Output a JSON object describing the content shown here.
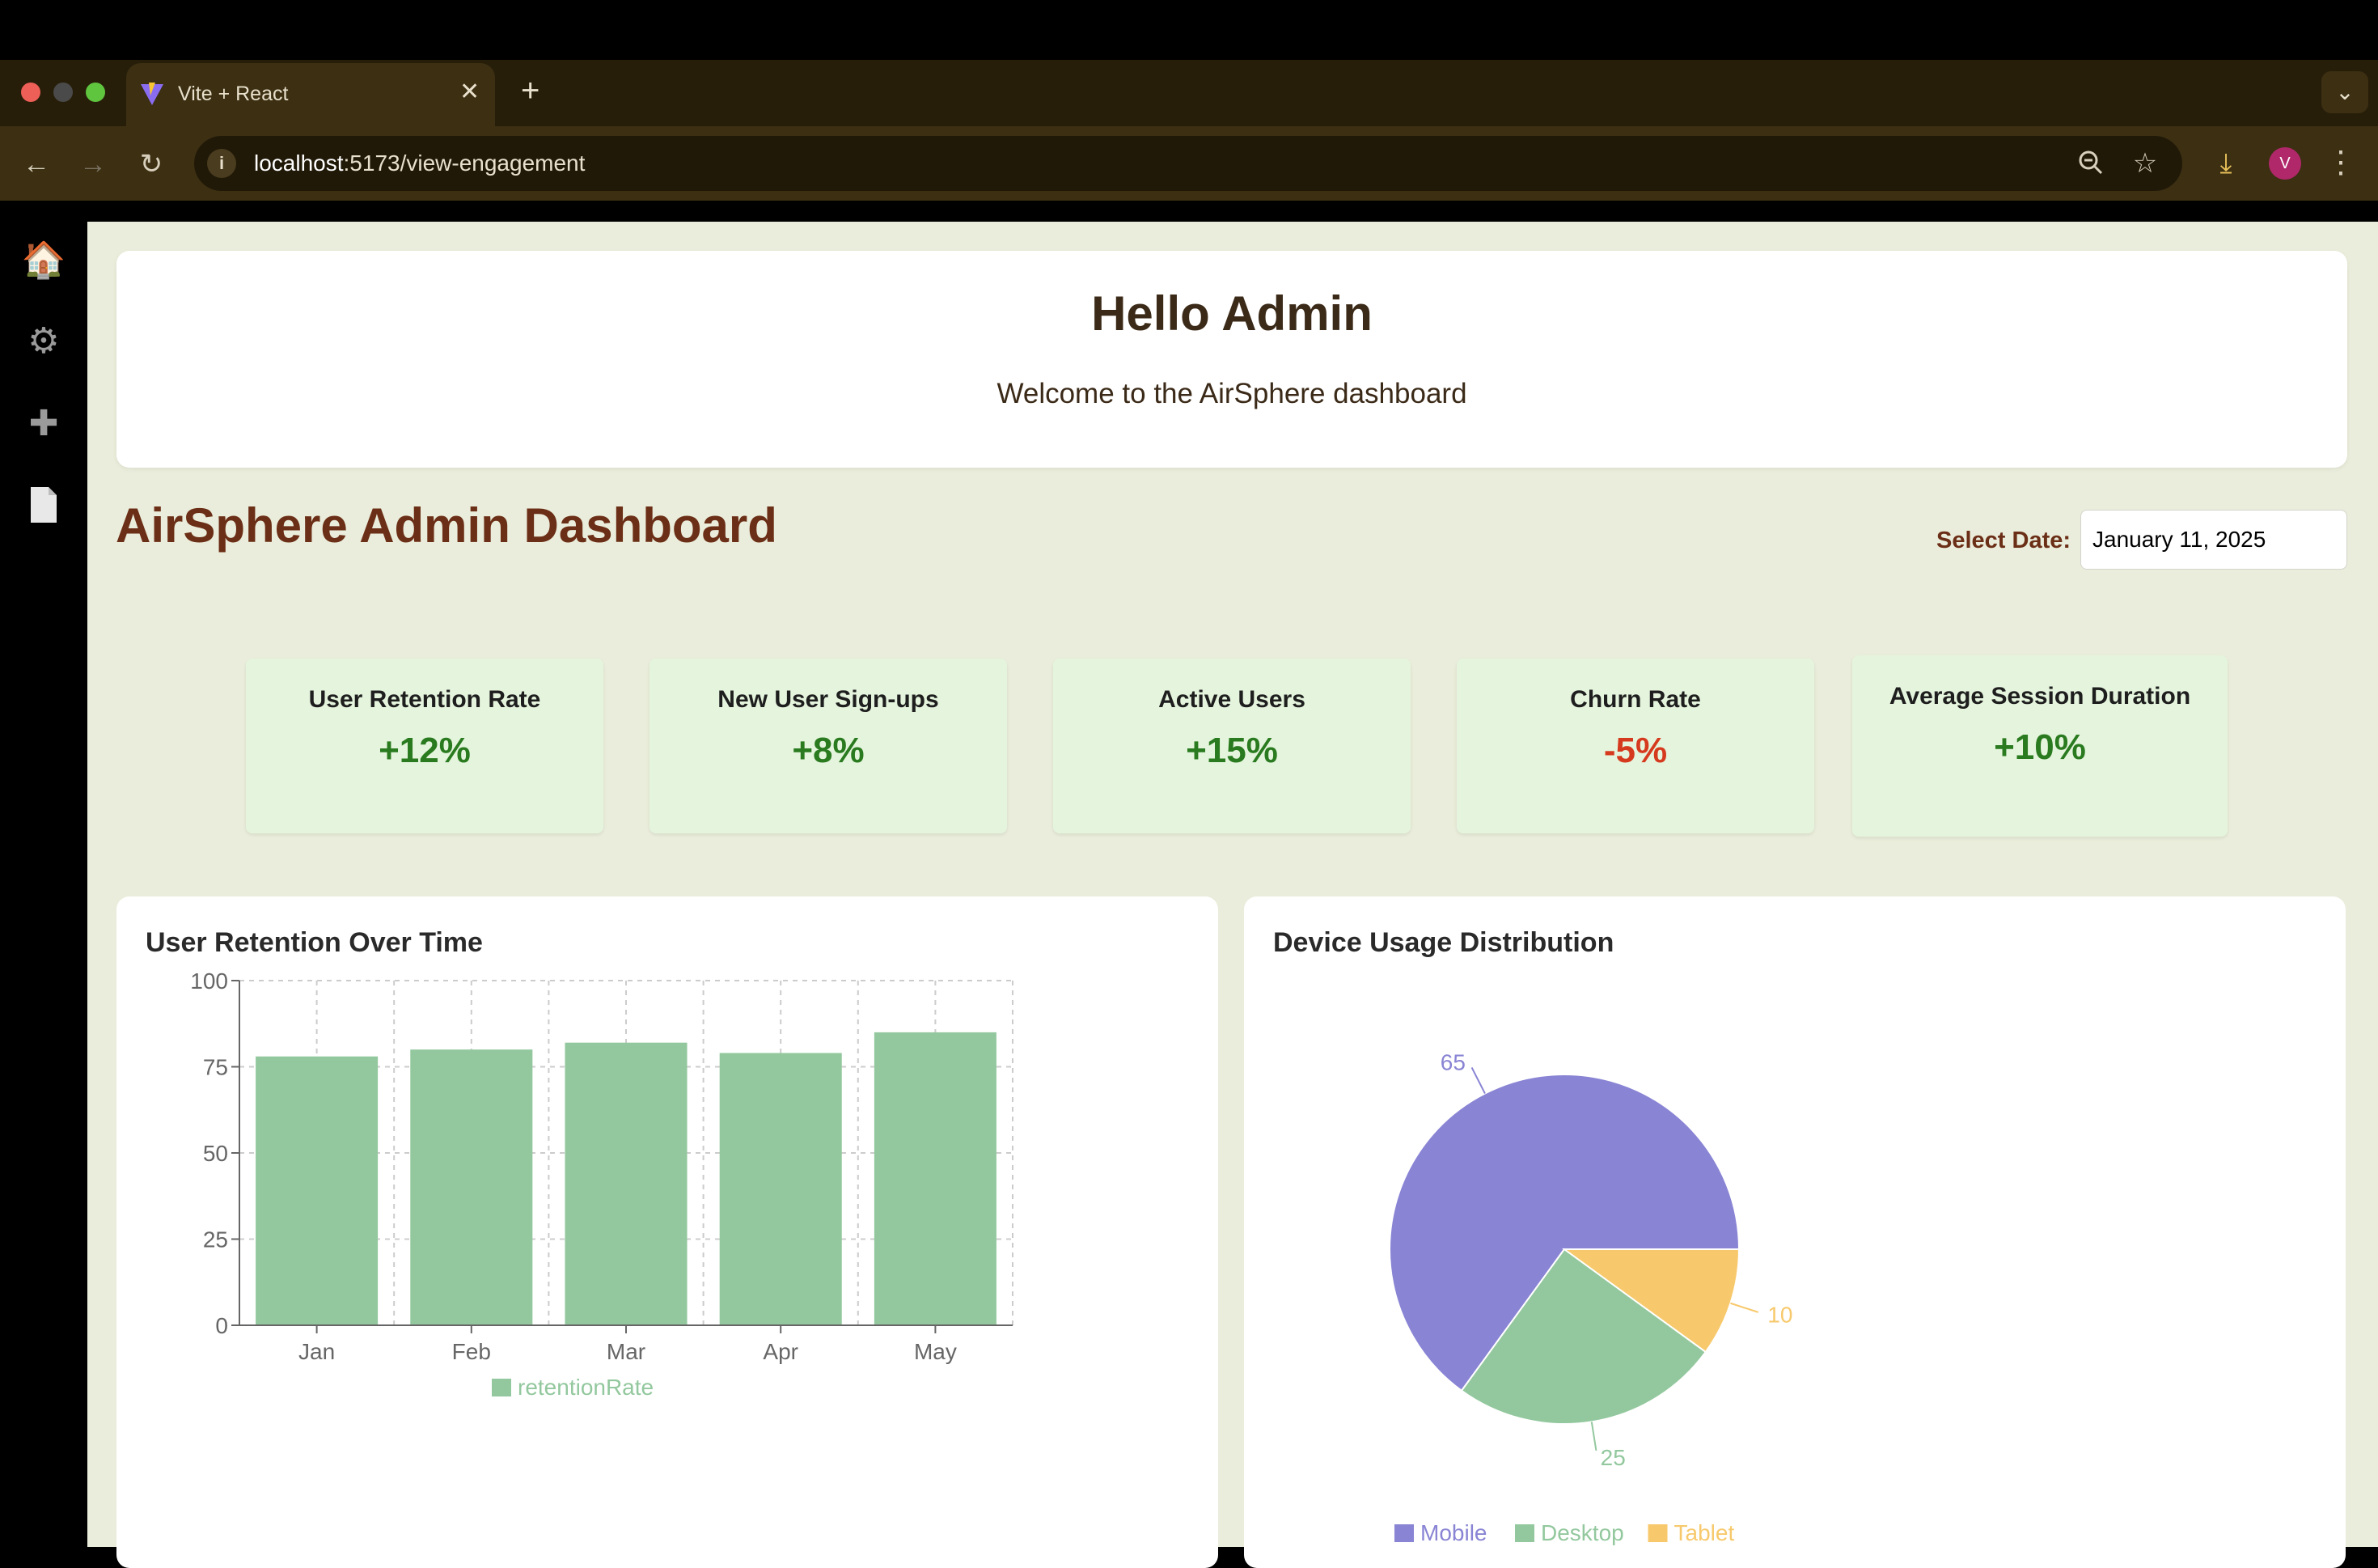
{
  "browser": {
    "tab_title": "Vite + React",
    "tab_close": "✕",
    "new_tab": "+",
    "tab_menu": "⌄",
    "url_host": "localhost",
    "url_path": ":5173/view-engagement",
    "site_info": "i",
    "profile_initial": "V"
  },
  "header": {
    "greeting": "Hello Admin",
    "welcome": "Welcome to the AirSphere dashboard"
  },
  "dashboard": {
    "title": "AirSphere Admin Dashboard",
    "date_label": "Select Date:",
    "date_value": "January 11, 2025"
  },
  "metrics": [
    {
      "label": "User Retention Rate",
      "value": "+12%"
    },
    {
      "label": "New User Sign-ups",
      "value": "+8%"
    },
    {
      "label": "Active Users",
      "value": "+15%"
    },
    {
      "label": "Churn Rate",
      "value": "-5%"
    },
    {
      "label": "Average Session Duration",
      "value": "+10%"
    }
  ],
  "charts": {
    "retention_title": "User Retention Over Time",
    "device_title": "Device Usage Distribution"
  },
  "colors": {
    "retention_bar": "#93c89e",
    "mobile": "#8984d4",
    "desktop": "#93c89e",
    "tablet": "#f7c96c",
    "positive": "#2a7a1f",
    "negative": "#d63a1e",
    "title_brown": "#6b2e16"
  },
  "icons": {
    "sidebar": [
      "home-icon",
      "gear-icon",
      "plus-icon",
      "document-icon"
    ],
    "toolbar": [
      "back-arrow-icon",
      "forward-arrow-icon",
      "reload-icon",
      "zoom-icon",
      "star-icon",
      "download-icon",
      "more-vert-icon"
    ]
  },
  "chart_data": [
    {
      "type": "bar",
      "title": "User Retention Over Time",
      "categories": [
        "Jan",
        "Feb",
        "Mar",
        "Apr",
        "May"
      ],
      "series": [
        {
          "name": "retentionRate",
          "values": [
            78,
            80,
            82,
            79,
            85
          ]
        }
      ],
      "ylim": [
        0,
        100
      ],
      "yticks": [
        0,
        25,
        50,
        75,
        100
      ],
      "grid": true,
      "legend": "bottom"
    },
    {
      "type": "pie",
      "title": "Device Usage Distribution",
      "slices": [
        {
          "name": "Mobile",
          "value": 65
        },
        {
          "name": "Desktop",
          "value": 25
        },
        {
          "name": "Tablet",
          "value": 10
        }
      ],
      "legend": "bottom"
    }
  ]
}
